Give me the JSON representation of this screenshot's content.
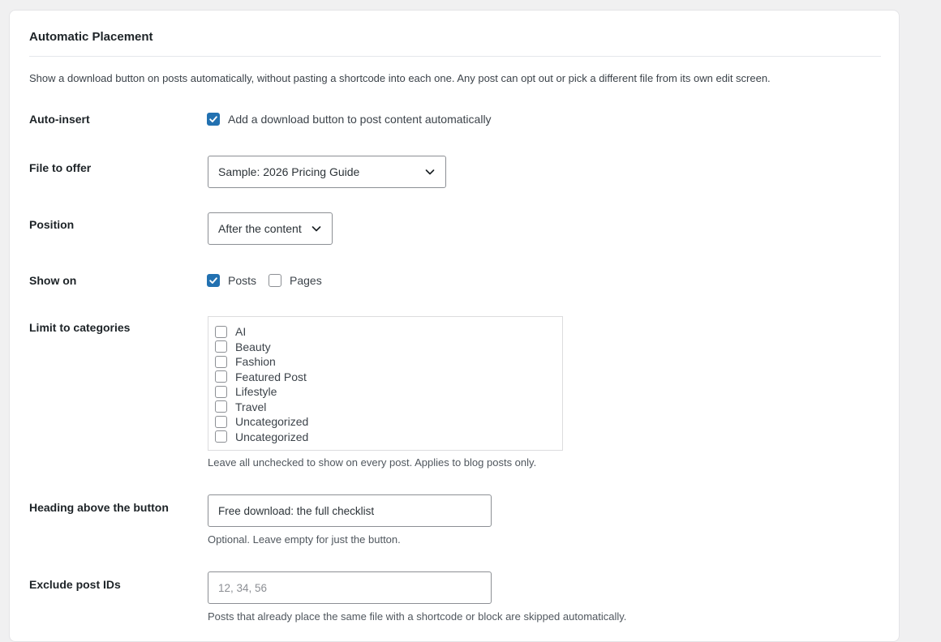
{
  "section": {
    "title": "Automatic Placement",
    "description": "Show a download button on posts automatically, without pasting a shortcode into each one. Any post can opt out or pick a different file from its own edit screen."
  },
  "auto_insert": {
    "label": "Auto-insert",
    "checkbox_label": "Add a download button to post content automatically",
    "checked": true
  },
  "file_to_offer": {
    "label": "File to offer",
    "selected": "Sample: 2026 Pricing Guide"
  },
  "position": {
    "label": "Position",
    "selected": "After the content"
  },
  "show_on": {
    "label": "Show on",
    "options": [
      {
        "label": "Posts",
        "checked": true
      },
      {
        "label": "Pages",
        "checked": false
      }
    ]
  },
  "categories": {
    "label": "Limit to categories",
    "items": [
      {
        "label": "AI",
        "checked": false
      },
      {
        "label": "Beauty",
        "checked": false
      },
      {
        "label": "Fashion",
        "checked": false
      },
      {
        "label": "Featured Post",
        "checked": false
      },
      {
        "label": "Lifestyle",
        "checked": false
      },
      {
        "label": "Travel",
        "checked": false
      },
      {
        "label": "Uncategorized",
        "checked": false
      },
      {
        "label": "Uncategorized",
        "checked": false
      }
    ],
    "help": "Leave all unchecked to show on every post. Applies to blog posts only."
  },
  "heading": {
    "label": "Heading above the button",
    "value": "Free download: the full checklist",
    "help": "Optional. Leave empty for just the button."
  },
  "exclude": {
    "label": "Exclude post IDs",
    "value": "",
    "placeholder": "12, 34, 56",
    "help": "Posts that already place the same file with a shortcode or block are skipped automatically."
  },
  "icons": {
    "checkmark": "checkmark-icon",
    "chevron": "chevron-down-icon"
  },
  "colors": {
    "accent": "#2271b1",
    "page_background": "#f0f0f1",
    "card_background": "#ffffff"
  }
}
